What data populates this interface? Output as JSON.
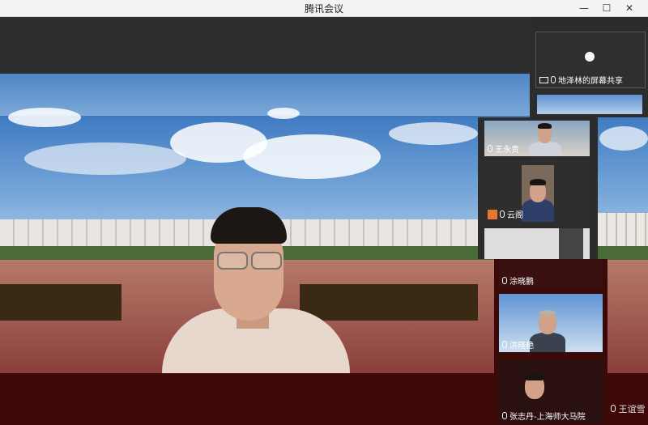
{
  "window": {
    "title": "腾讯会议",
    "minimize": "—",
    "maximize": "☐",
    "close": "✕"
  },
  "screen_share": {
    "label": "地泽林的屏幕共享"
  },
  "participants": [
    {
      "name": "王永贵"
    },
    {
      "name": "云阁"
    },
    {
      "name": "涂晓鹏"
    },
    {
      "name": "洪晓艳"
    },
    {
      "name": "张志丹-上海师大马院"
    }
  ],
  "bottom_partial_name": "王谊雪"
}
